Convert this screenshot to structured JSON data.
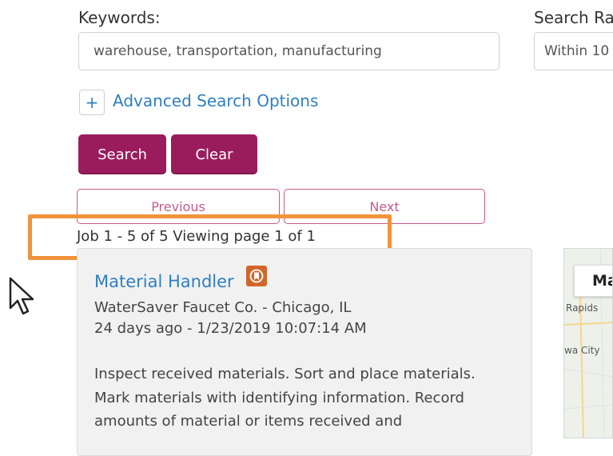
{
  "search": {
    "keywords_label": "Keywords:",
    "keywords_value": "warehouse, transportation, manufacturing",
    "radius_label": "Search Ra",
    "radius_value": "Within 10",
    "advanced_plus": "+",
    "advanced_label": "Advanced Search Options",
    "search_button": "Search",
    "clear_button": "Clear"
  },
  "pagination": {
    "previous": "Previous",
    "next": "Next",
    "summary": "Job 1 - 5 of 5 Viewing page 1 of 1"
  },
  "job": {
    "title": "Material Handler",
    "company_location": "WaterSaver Faucet Co. - Chicago, IL",
    "posted": "24 days ago - 1/23/2019 10:07:14 AM",
    "description": "Inspect received materials. Sort and place materials. Mark materials with identifying information. Record amounts of material or items received and"
  },
  "map": {
    "control_label": "Ma",
    "place_1": "Rapids",
    "place_2": "wa City"
  },
  "colors": {
    "accent": "#9a1c5d",
    "link": "#2f7fc1",
    "highlight": "#f2933a",
    "bookmark": "#d2652a"
  },
  "icons": [
    "plus-icon",
    "bookmark-icon",
    "mouse-cursor-icon"
  ]
}
